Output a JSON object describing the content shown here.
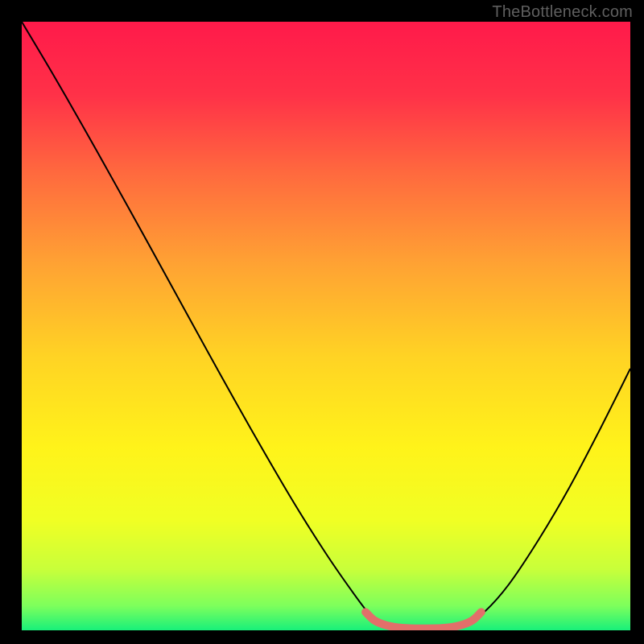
{
  "attribution": "TheBottleneck.com",
  "chart_data": {
    "type": "line",
    "xlabel": "",
    "ylabel": "",
    "xlim": [
      0,
      1
    ],
    "ylim": [
      0,
      1
    ],
    "background": {
      "type": "vertical-gradient",
      "stops": [
        {
          "pos": 0.0,
          "color": "#ff1a4a"
        },
        {
          "pos": 0.12,
          "color": "#ff3148"
        },
        {
          "pos": 0.25,
          "color": "#ff6a3e"
        },
        {
          "pos": 0.4,
          "color": "#ffa333"
        },
        {
          "pos": 0.55,
          "color": "#ffd324"
        },
        {
          "pos": 0.7,
          "color": "#fff31a"
        },
        {
          "pos": 0.82,
          "color": "#f0ff24"
        },
        {
          "pos": 0.9,
          "color": "#c8ff3a"
        },
        {
          "pos": 0.96,
          "color": "#7dff5c"
        },
        {
          "pos": 1.0,
          "color": "#18f07a"
        }
      ]
    },
    "series": [
      {
        "name": "bottleneck-curve",
        "color": "#000000",
        "points": [
          {
            "x": 0.0,
            "y": 1.0
          },
          {
            "x": 0.05,
            "y": 0.916
          },
          {
            "x": 0.1,
            "y": 0.829
          },
          {
            "x": 0.15,
            "y": 0.74
          },
          {
            "x": 0.2,
            "y": 0.65
          },
          {
            "x": 0.25,
            "y": 0.559
          },
          {
            "x": 0.3,
            "y": 0.468
          },
          {
            "x": 0.35,
            "y": 0.378
          },
          {
            "x": 0.4,
            "y": 0.29
          },
          {
            "x": 0.45,
            "y": 0.205
          },
          {
            "x": 0.5,
            "y": 0.126
          },
          {
            "x": 0.54,
            "y": 0.068
          },
          {
            "x": 0.57,
            "y": 0.028
          },
          {
            "x": 0.59,
            "y": 0.01
          },
          {
            "x": 0.61,
            "y": 0.004
          },
          {
            "x": 0.64,
            "y": 0.002
          },
          {
            "x": 0.68,
            "y": 0.002
          },
          {
            "x": 0.71,
            "y": 0.004
          },
          {
            "x": 0.73,
            "y": 0.01
          },
          {
            "x": 0.76,
            "y": 0.03
          },
          {
            "x": 0.8,
            "y": 0.075
          },
          {
            "x": 0.85,
            "y": 0.15
          },
          {
            "x": 0.9,
            "y": 0.235
          },
          {
            "x": 0.95,
            "y": 0.33
          },
          {
            "x": 1.0,
            "y": 0.43
          }
        ]
      },
      {
        "name": "valley-highlight",
        "color": "#e26f6a",
        "thick": true,
        "points": [
          {
            "x": 0.565,
            "y": 0.03
          },
          {
            "x": 0.58,
            "y": 0.016
          },
          {
            "x": 0.6,
            "y": 0.008
          },
          {
            "x": 0.625,
            "y": 0.004
          },
          {
            "x": 0.66,
            "y": 0.003
          },
          {
            "x": 0.695,
            "y": 0.004
          },
          {
            "x": 0.72,
            "y": 0.008
          },
          {
            "x": 0.74,
            "y": 0.016
          },
          {
            "x": 0.755,
            "y": 0.03
          }
        ]
      }
    ]
  }
}
